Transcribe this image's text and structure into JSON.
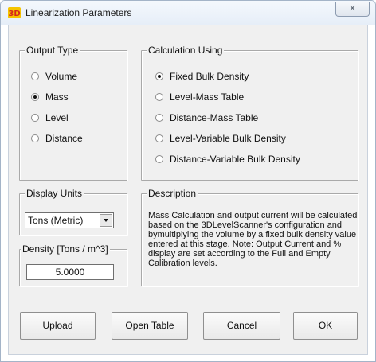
{
  "window": {
    "title": "Linearization Parameters",
    "close_glyph": "✕",
    "icon": "app-logo-icon"
  },
  "output_type": {
    "legend": "Output Type",
    "options": [
      {
        "label": "Volume",
        "selected": false
      },
      {
        "label": "Mass",
        "selected": true
      },
      {
        "label": "Level",
        "selected": false
      },
      {
        "label": "Distance",
        "selected": false
      }
    ]
  },
  "calculation": {
    "legend": "Calculation Using",
    "options": [
      {
        "label": "Fixed Bulk Density",
        "selected": true
      },
      {
        "label": "Level-Mass Table",
        "selected": false
      },
      {
        "label": "Distance-Mass Table",
        "selected": false
      },
      {
        "label": "Level-Variable Bulk Density",
        "selected": false
      },
      {
        "label": "Distance-Variable Bulk Density",
        "selected": false
      }
    ]
  },
  "display_units": {
    "legend": "Display Units",
    "value": "Tons (Metric)"
  },
  "density": {
    "legend": "Density [Tons / m^3]",
    "value": "5.0000"
  },
  "description": {
    "legend": "Description",
    "text": "Mass Calculation and output current will be calculated based on the 3DLevelScanner's configuration and bymultiplying the volume by a fixed bulk density value entered at this stage. Note: Output Current and % display are set according to the Full and Empty Calibration levels."
  },
  "buttons": {
    "upload": "Upload",
    "open_table": "Open Table",
    "cancel": "Cancel",
    "ok": "OK"
  },
  "colors": {
    "dialog_bg": "#f0f0f0",
    "titlebar": "#e6eef8",
    "frame": "#a4b4c8",
    "logo_red": "#d6261c",
    "logo_yellow": "#f5c400"
  }
}
